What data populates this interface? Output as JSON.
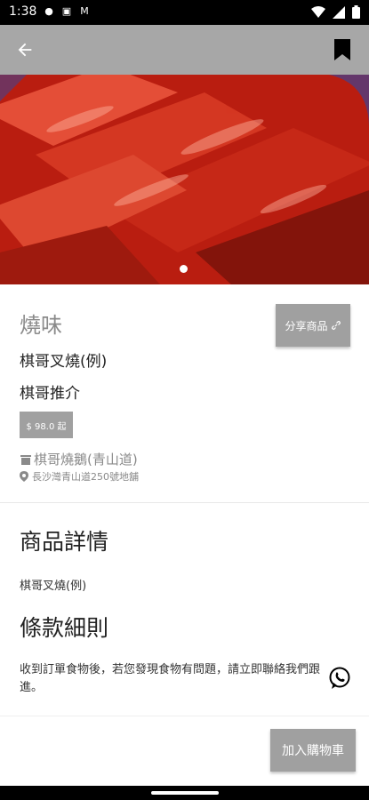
{
  "status_bar": {
    "time": "1:38",
    "notification_icons": [
      "message-icon",
      "image-icon",
      "gmail-icon"
    ],
    "right_icons": [
      "wifi-icon",
      "signal-icon",
      "battery-icon"
    ]
  },
  "app_bar": {
    "background": "#a7a7a7",
    "back_icon": "arrow-left-icon",
    "bookmark_icon": "bookmark-icon"
  },
  "hero": {
    "description_icon": "food-photo",
    "carousel_index": 1,
    "carousel_count": 1
  },
  "product": {
    "category": "燒味",
    "share_label": "分享商品",
    "name": "棋哥叉燒(例)",
    "recommend": "棋哥推介",
    "price_label": "$ 98.0 起",
    "shop_name": "棋哥燒鵝(青山道)",
    "address": "長沙灣青山道250號地舖"
  },
  "details": {
    "heading": "商品詳情",
    "text": "棋哥叉燒(例)"
  },
  "terms": {
    "heading": "條款細則",
    "text": "收到訂單食物後，若您發現食物有問題，請立即聯絡我們跟進。"
  },
  "actions": {
    "add_to_cart": "加入購物車",
    "whatsapp_icon": "whatsapp-icon"
  },
  "colors": {
    "button_gray": "#a0a0a0",
    "muted_text": "#8a8a8a"
  }
}
